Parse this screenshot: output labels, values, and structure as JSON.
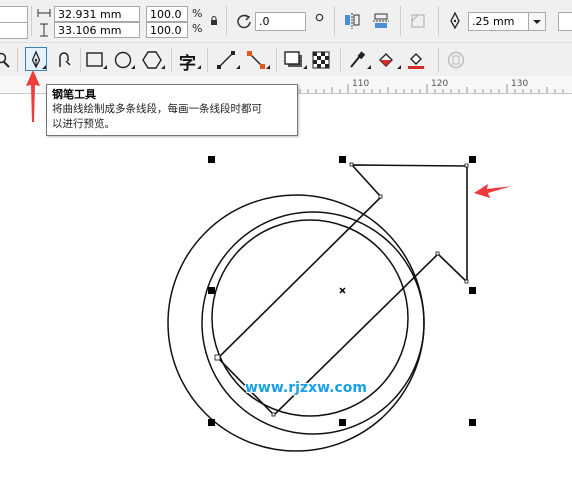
{
  "property_bar": {
    "width_value": "32.931 mm",
    "height_value": "33.106 mm",
    "scale_x": "100.0",
    "scale_y": "100.0",
    "percent_symbol": "%",
    "rotation_value": ".0",
    "outline_width": ".25 mm"
  },
  "toolbox": {
    "active_tool": "pen-tool",
    "text_tool_glyph": "字"
  },
  "ruler": {
    "ticks": [
      "110",
      "120",
      "130"
    ]
  },
  "tooltip": {
    "title": "钢笔工具",
    "description_line1": "将曲线绘制成多条线段，每画一条线段时都可",
    "description_line2": "以进行预览。"
  },
  "watermark": {
    "text": "www.rjzxw.com"
  },
  "colors": {
    "annotation_arrow": "#ee3b3b",
    "watermark": "#1aa0e6",
    "selection_handle": "#000000"
  }
}
